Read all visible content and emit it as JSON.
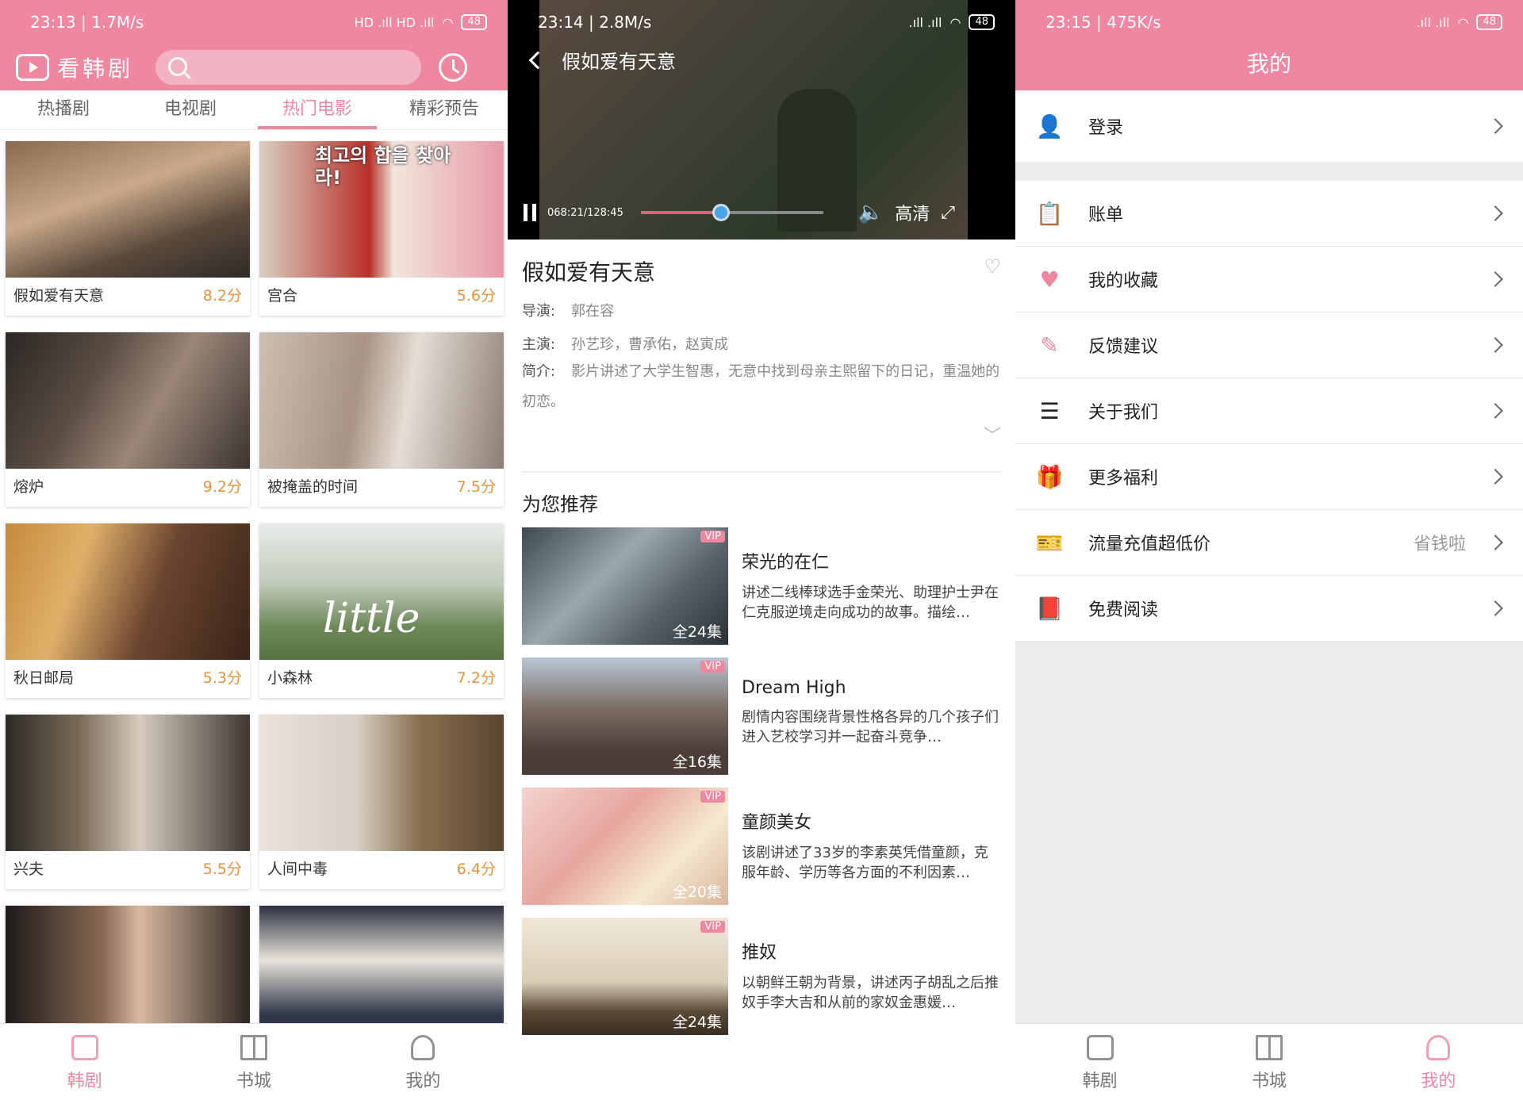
{
  "colors": {
    "accent": "#ef87a0",
    "score": "#e8933a",
    "vip": "#ef87a0"
  },
  "panel1": {
    "status": {
      "time": "23:13 | 1.7M/s",
      "battery": "48",
      "signal": "HD .ıll HD .ıll"
    },
    "app_name": "看韩剧",
    "tabs": [
      {
        "label": "热播剧"
      },
      {
        "label": "电视剧"
      },
      {
        "label": "热门电影"
      },
      {
        "label": "精彩预告"
      }
    ],
    "active_tab": "热门电影",
    "movies": [
      {
        "title": "假如爱有天意",
        "score": "8.2分"
      },
      {
        "title": "宫合",
        "score": "5.6分"
      },
      {
        "title": "熔炉",
        "score": "9.2分"
      },
      {
        "title": "被掩盖的时间",
        "score": "7.5分"
      },
      {
        "title": "秋日邮局",
        "score": "5.3分"
      },
      {
        "title": "小森林",
        "score": "7.2分"
      },
      {
        "title": "兴夫",
        "score": "5.5分"
      },
      {
        "title": "人间中毒",
        "score": "6.4分"
      }
    ],
    "poster_texts": {
      "p2": "최고의 합을 찾아라!",
      "p6": "little"
    }
  },
  "panel2": {
    "status": {
      "time": "23:14 | 2.8M/s",
      "battery": "48"
    },
    "video_title": "假如爱有天意",
    "time_display": "068:21/128:45",
    "progress": 0.44,
    "quality": "高清",
    "movie": {
      "title": "假如爱有天意",
      "director_label": "导演:",
      "director": "郭在容",
      "cast_label": "主演:",
      "cast": "孙艺珍，曹承佑，赵寅成",
      "intro_label": "简介:",
      "intro": "影片讲述了大学生智惠，无意中找到母亲主熙留下的日记，重温她的初恋。"
    },
    "recommend_title": "为您推荐",
    "recommendations": [
      {
        "title": "荣光的在仁",
        "desc": "讲述二线棒球选手金荣光、助理护士尹在仁克服逆境走向成功的故事。描绘…",
        "episodes": "全24集",
        "vip": "VIP"
      },
      {
        "title": "Dream High",
        "desc": "剧情内容围绕背景性格各异的几个孩子们进入艺校学习并一起奋斗竞争…",
        "episodes": "全16集",
        "vip": "VIP"
      },
      {
        "title": "童颜美女",
        "desc": "该剧讲述了33岁的李素英凭借童颜，克服年龄、学历等各方面的不利因素…",
        "episodes": "全20集",
        "vip": "VIP"
      },
      {
        "title": "推奴",
        "desc": "以朝鲜王朝为背景，讲述丙子胡乱之后推奴手李大吉和从前的家奴金惠媛…",
        "episodes": "全24集",
        "vip": "VIP"
      }
    ]
  },
  "panel3": {
    "status": {
      "time": "23:15 | 475K/s",
      "battery": "48"
    },
    "title": "我的",
    "login": "登录",
    "menu": [
      {
        "label": "账单",
        "hint": ""
      },
      {
        "label": "我的收藏",
        "hint": ""
      },
      {
        "label": "反馈建议",
        "hint": ""
      },
      {
        "label": "关于我们",
        "hint": ""
      },
      {
        "label": "更多福利",
        "hint": ""
      },
      {
        "label": "流量充值超低价",
        "hint": "省钱啦"
      },
      {
        "label": "免费阅读",
        "hint": ""
      }
    ]
  },
  "bottom_nav": [
    {
      "label": "韩剧",
      "icon": "tv-icon"
    },
    {
      "label": "书城",
      "icon": "book-icon"
    },
    {
      "label": "我的",
      "icon": "user-icon"
    }
  ]
}
